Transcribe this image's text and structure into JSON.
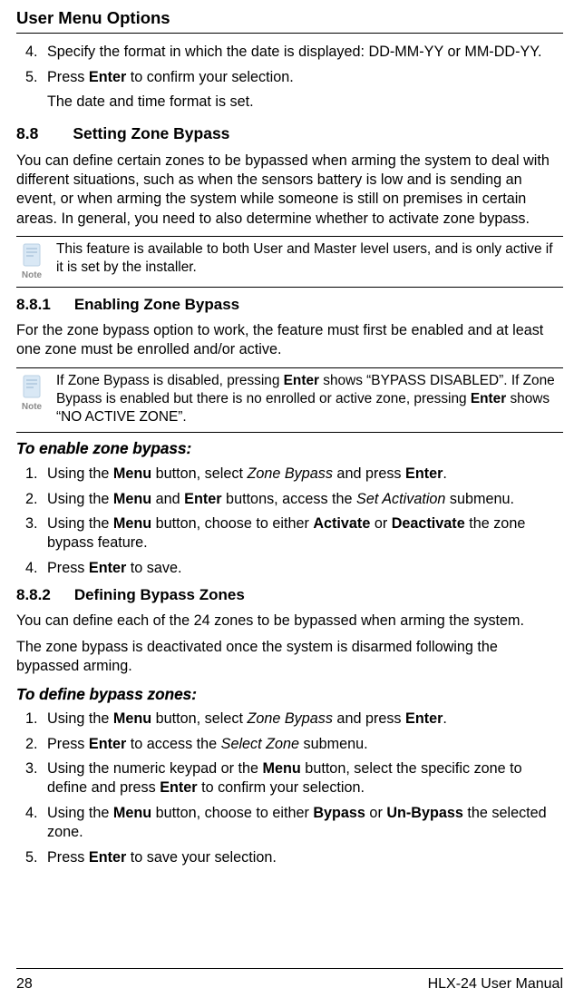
{
  "pageTitle": "User Menu Options",
  "topList": {
    "start": 4,
    "items": [
      {
        "p1": "Specify the format in which the date is displayed: DD-MM-YY or MM-DD-YY."
      },
      {
        "p1_html": "Press <b>Enter</b> to confirm your selection.",
        "p2": "The date and time format is set."
      }
    ]
  },
  "sec88": {
    "num": "8.8",
    "title": "Setting Zone Bypass"
  },
  "p_intro88": "You can define certain zones to be bypassed when arming the system to deal with different situations, such as when the sensors battery is low and is sending an event, or when arming the system while someone is still on premises in certain areas. In general, you need to also determine whether to activate zone bypass.",
  "note1": "This feature is available to both User and Master level users, and is only active if it is set by the installer.",
  "noteLabel": "Note",
  "sec881": {
    "num": "8.8.1",
    "title": "Enabling Zone Bypass"
  },
  "p_881": "For the zone bypass option to work, the feature must first be enabled and at least one zone must be enrolled and/or active.",
  "note2_html": "If Zone Bypass is disabled, pressing <b>Enter</b> shows “BYPASS DISABLED”. If Zone Bypass is enabled but there is no enrolled or active zone, pressing <b>Enter</b> shows “NO ACTIVE ZONE”.",
  "proc1_title": "To enable zone bypass:",
  "proc1": [
    "Using the <b>Menu</b> button, select <span class=\"italic\">Zone Bypass</span> and press <b>Enter</b>.",
    "Using the <b>Menu</b> and <b>Enter</b> buttons, access the <span class=\"italic\">Set Activation</span> submenu.",
    "Using the <b>Menu</b> button, choose to either <b>Activate</b> or <b>Deactivate</b> the zone bypass feature.",
    "Press <b>Enter</b> to save."
  ],
  "sec882": {
    "num": "8.8.2",
    "title": "Defining Bypass Zones"
  },
  "p_882a": "You can define each of the 24 zones to be bypassed when arming the system.",
  "p_882b": "The zone bypass is deactivated once the system is disarmed following the bypassed arming.",
  "proc2_title": "To define bypass zones:",
  "proc2": [
    "Using the <b>Menu</b> button, select <span class=\"italic\">Zone Bypass</span> and press <b>Enter</b>.",
    "Press <b>Enter</b> to access the <span class=\"italic\">Select Zone</span> submenu.",
    "Using the numeric keypad or the <b>Menu</b> button, select the specific zone to define and press <b>Enter</b> to confirm your selection.",
    "Using the <b>Menu</b> button, choose to either <b>Bypass</b> or <b>Un-Bypass</b> the selected zone.",
    "Press <b>Enter</b> to save your selection."
  ],
  "footer": {
    "pageNum": "28",
    "docTitle": "HLX-24 User Manual"
  }
}
